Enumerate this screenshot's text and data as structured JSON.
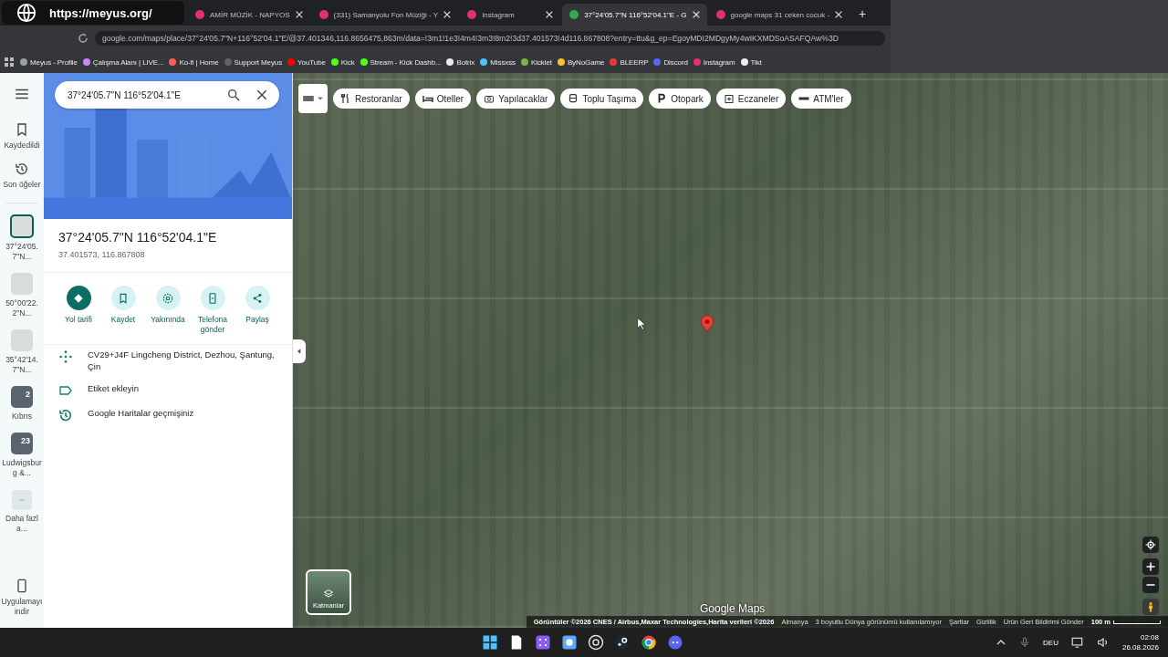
{
  "stream_overlay": {
    "url": "https://meyus.org/"
  },
  "browser": {
    "tabs": [
      {
        "title": "AMİR MÜZİK - NAPYOS",
        "selected": false
      },
      {
        "title": "(331) Samanyolu Fon Müziği - Y",
        "selected": false
      },
      {
        "title": "Instagram",
        "selected": false
      },
      {
        "title": "37°24'05.7\"N 116°52'04.1\"E - G",
        "selected": true
      },
      {
        "title": "google maps 31 ceken cocuk - ",
        "selected": false
      }
    ],
    "new_tab": "+",
    "address": "google.com/maps/place/37°24'05.7\"N+116°52'04.1\"E/@37.401346,116.8656475,863m/data=!3m1!1e3!4m4!3m3!8m2!3d37.401573!4d116.867808?entry=ttu&g_ep=EgoyMDI2MDgyMy4wIKXMDSoASAFQAw%3D",
    "bookmarks": [
      {
        "label": "Meyus - Profile",
        "color": "#9aa0a6"
      },
      {
        "label": "Çalışma Alanı | LIVE...",
        "color": "#c58af9"
      },
      {
        "label": "Ko-fi | Home",
        "color": "#ff5e5b"
      },
      {
        "label": "Support Meyus",
        "color": "#5f6368"
      },
      {
        "label": "YouTube",
        "color": "#ff0000"
      },
      {
        "label": "Kick",
        "color": "#53fc18"
      },
      {
        "label": "Stream - Kick Dashb...",
        "color": "#53fc18"
      },
      {
        "label": "Botrix",
        "color": "#e8eaed"
      },
      {
        "label": "Missxss",
        "color": "#4fc3f7"
      },
      {
        "label": "Kicklet",
        "color": "#7cb342"
      },
      {
        "label": "ByNoGame",
        "color": "#fbc02d"
      },
      {
        "label": "BLEERP",
        "color": "#e53935"
      },
      {
        "label": "Discord",
        "color": "#5865f2"
      },
      {
        "label": "Instagram",
        "color": "#e1306c"
      },
      {
        "label": "Tikt",
        "color": "#eeeeee"
      }
    ]
  },
  "rail": {
    "saved": "Kaydedildi",
    "recent": "Son öğeler",
    "recents": [
      {
        "label": "37°24'05.7\"N...",
        "selected": true
      },
      {
        "label": "50°00'22.2\"N...",
        "selected": false
      },
      {
        "label": "35°42'14.7\"N...",
        "selected": false
      },
      {
        "label": "Kıbrıs",
        "badge": "2",
        "selected": false
      },
      {
        "label": "Ludwigsburg &...",
        "badge": "23",
        "selected": false
      }
    ],
    "more": "Daha fazla...",
    "get_app": "Uygulamayı indir"
  },
  "place": {
    "search_value": "37°24'05.7\"N 116°52'04.1\"E",
    "title": "37°24'05.7\"N 116°52'04.1\"E",
    "coords": "37.401573, 116.867808",
    "actions": [
      {
        "label": "Yol tarifi",
        "kind": "directions"
      },
      {
        "label": "Kaydet",
        "kind": "save"
      },
      {
        "label": "Yakınında",
        "kind": "nearby"
      },
      {
        "label": "Telefona gönder",
        "kind": "phone"
      },
      {
        "label": "Paylaş",
        "kind": "share"
      }
    ],
    "info": [
      {
        "text": "CV29+J4F Lingcheng District, Dezhou, Şantung, Çin",
        "kind": "pluscode"
      },
      {
        "text": "Etiket ekleyin",
        "kind": "label"
      },
      {
        "text": "Google Haritalar geçmişiniz",
        "kind": "history"
      }
    ]
  },
  "map": {
    "chips": [
      {
        "label": "Restoranlar",
        "kind": "food"
      },
      {
        "label": "Oteller",
        "kind": "hotel"
      },
      {
        "label": "Yapılacaklar",
        "kind": "camera"
      },
      {
        "label": "Toplu Taşıma",
        "kind": "transit"
      },
      {
        "label": "Otopark",
        "kind": "parking"
      },
      {
        "label": "Eczaneler",
        "kind": "pharmacy"
      },
      {
        "label": "ATM'ler",
        "kind": "atm"
      }
    ],
    "layers": "Katmanlar",
    "brand": "Google Maps",
    "footer": [
      "Görüntüler ©2026 CNES / Airbus,Maxar Technologies,Harita verileri ©2026",
      "Almanya",
      "3 boyutlu Dünya görünümü kullanılamıyor",
      "Şartlar",
      "Gizlilik",
      "Ürün Geri Bildirimi Gönder"
    ],
    "scale": "100 m"
  },
  "taskbar": {
    "language": "DEU",
    "time": "02:08",
    "date": "26.08.2026"
  }
}
